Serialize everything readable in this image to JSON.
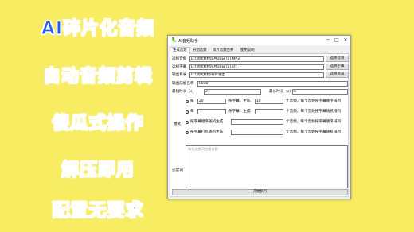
{
  "promo": [
    "AI碎片化音频",
    "自动音频剪辑",
    "傻瓜式操作",
    "解压即用",
    "配置无要求"
  ],
  "window": {
    "title": "AI音频助手",
    "icon": "parrot-icon",
    "min_glyph": "─",
    "max_glyph": "□",
    "close_glyph": "✕"
  },
  "tabs": [
    "生成音频",
    "分割音频",
    "碎片音频合并",
    "使用说明"
  ],
  "form": {
    "audio_label": "选择音频",
    "audio_value": "D:/测试素材/8月18日 (1).MP3",
    "audio_button": "选择音频",
    "subtitle_label": "选择字幕",
    "subtitle_value": "D:/测试素材/8月18日 (1).srt",
    "subtitle_button": "选择字幕",
    "output_label": "输出目录",
    "output_value": "D:/测试素材/碎片输出",
    "output_button": "选择目录",
    "prefix_label": "输出前缀名称",
    "prefix_value": "0818",
    "min_label": "最短时长（s）",
    "min_value": "2",
    "max_label": "最长时长（s）",
    "max_value": "5",
    "mode_label": "模式",
    "mode1_a": "每",
    "mode1_n": "20",
    "mode1_b": "条字幕，生成",
    "mode1_m": "10",
    "mode1_c": "个音频，每个音频按字幕顺序排列",
    "mode2_a": "每",
    "mode2_b": "条字幕，生成",
    "mode2_c": "个音频，每个音频按字幕随机排列",
    "mode3_a": "按字幕顺序随机生成",
    "mode3_c": "个音频，每个音频按字幕顺序排列",
    "mode4_a": "按字幕打乱随机生成",
    "mode4_c": "个音频，每个音频按字幕随机排列",
    "banned_label": "违禁词",
    "banned_placeholder": "每条违禁词空格分割",
    "start_button": "开始执行"
  },
  "colors": {
    "background": "#f7ec62",
    "promo_text": "#1d5cff"
  }
}
